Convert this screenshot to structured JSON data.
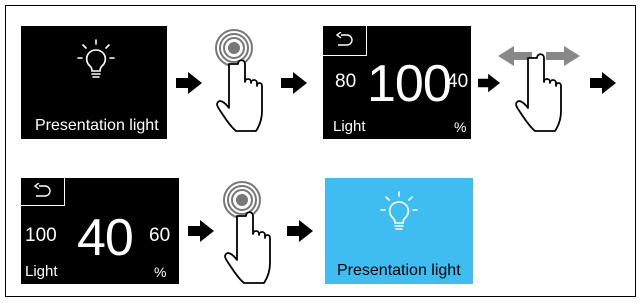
{
  "step1": {
    "label": "Presentation light",
    "icon": "lightbulb-icon"
  },
  "step2": {
    "icon": "finger-tap-icon"
  },
  "step3": {
    "left": "80",
    "value": "100",
    "right": "40",
    "label": "Light",
    "unit": "%",
    "icon": "back-icon"
  },
  "step4": {
    "icon": "finger-swipe-icon"
  },
  "step5": {
    "left": "100",
    "value": "40",
    "right": "60",
    "label": "Light",
    "unit": "%",
    "icon": "back-icon"
  },
  "step6": {
    "icon": "finger-tap-icon"
  },
  "step7": {
    "label": "Presentation light",
    "icon": "lightbulb-icon"
  },
  "colors": {
    "screen": "#000000",
    "highlight": "#3fbdf0",
    "arrow": "#000000",
    "swipe_arrow": "#808080"
  }
}
